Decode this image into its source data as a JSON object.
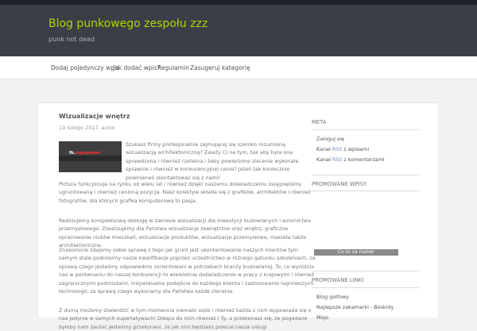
{
  "site": {
    "title": "Blog punkowego zespołu zzz",
    "tagline": "punk not dead"
  },
  "nav": {
    "items": [
      "Dodaj pojedynczy wpis",
      "Jak dodać wpis?",
      "Regulamin",
      "Zasugeruj kategorię"
    ]
  },
  "post": {
    "title": "Wizualizacje wnętrz",
    "date": "19 lutego 2017",
    "author": "autor",
    "thumb_logo_a": "fb.",
    "thumb_logo_b": "zzgopeeker",
    "paragraphs": [
      "Szukasz firmy profesjonalnie zajmującej się szeroko rozumianą wizualizacją architektoniczną? Zależy Ci na tym, tak aby była ona sprawdzona i również rzetelna i żeby powierzone zlecenie wykonała sprawnie i również w konkurencyjnej cenie? Jeżeli tak koniecznie powinieneś skontaktować się z nami!",
      "Pictura funkcjonuje na rynku od wielu lat i również dzięki naszemu doświadczeniu osiągnęliśmy ugruntowaną i również cenioną pozycję. Nasz kolektyw składa się z grafików, architektów i również fotografów, dla których grafika komputerowa to pasja.",
      "Realizujemy kompleksową obsługę w zakresie wizualizacji dla inwestycji budowlanych i wzornictwa przemysłowego. Zrealizujemy dla Państwa wizualizacje zewnętrzne oraz wnętrz, graficzne opracowanie rzutów mieszkań, wizualizacje produktów, wizualizacje przemysłowe, makieta także architektoniczne.",
      "Znakomicie zdajemy sobie sprawę z tego jak grunt jest ukontentowanie naszych klientów tym samym stale podnosimy nasze kwalifikacje poprzez uczestnictwo w różnego gatunku szkoleniach, za sprawą czego jesteśmy odpowiednio zorientowani w potrzebach branży budowlanej. To, co wyróżnia nas w porównaniu do naszej konkurencji to wieloletnie doświadczenie w pracy z krajowymi i również zagranicznymi podmiotami, indywidualne podejście do każdego klienta i zastosowanie najnowszych technologii, za sprawą czego wykonamy dla Państwa każde zlecenie.",
      "Z dumą możemy stwierdzić w tym momencie niemało osób i również każda z nich wypowiada się o nas jedynie w samych superlatywach! Dołącz do nich również i Ty, a przekonasz się, że pogadane byłoby nam zaufać jesteśmy przekonani, że jak nini będziesz polecał nasze usługi"
    ]
  },
  "sidebar": {
    "meta_title": "META",
    "meta_links": [
      {
        "text": "Zaloguj się",
        "rss": ""
      },
      {
        "text": "Kanał ",
        "rss": "RSS",
        "rest": " z wpisami"
      },
      {
        "text": "Kanał ",
        "rss": "RSS",
        "rest": " z komentarzami"
      }
    ],
    "promo_posts_title": "PROMOWANE WPISY",
    "promo_box": "Co to za numer",
    "promo_links_title": "PROMOWANE LINKI",
    "promo_links": [
      "Blog golfowy",
      "Najlepsze zakamarki - Beskidy",
      "Mojo"
    ]
  }
}
